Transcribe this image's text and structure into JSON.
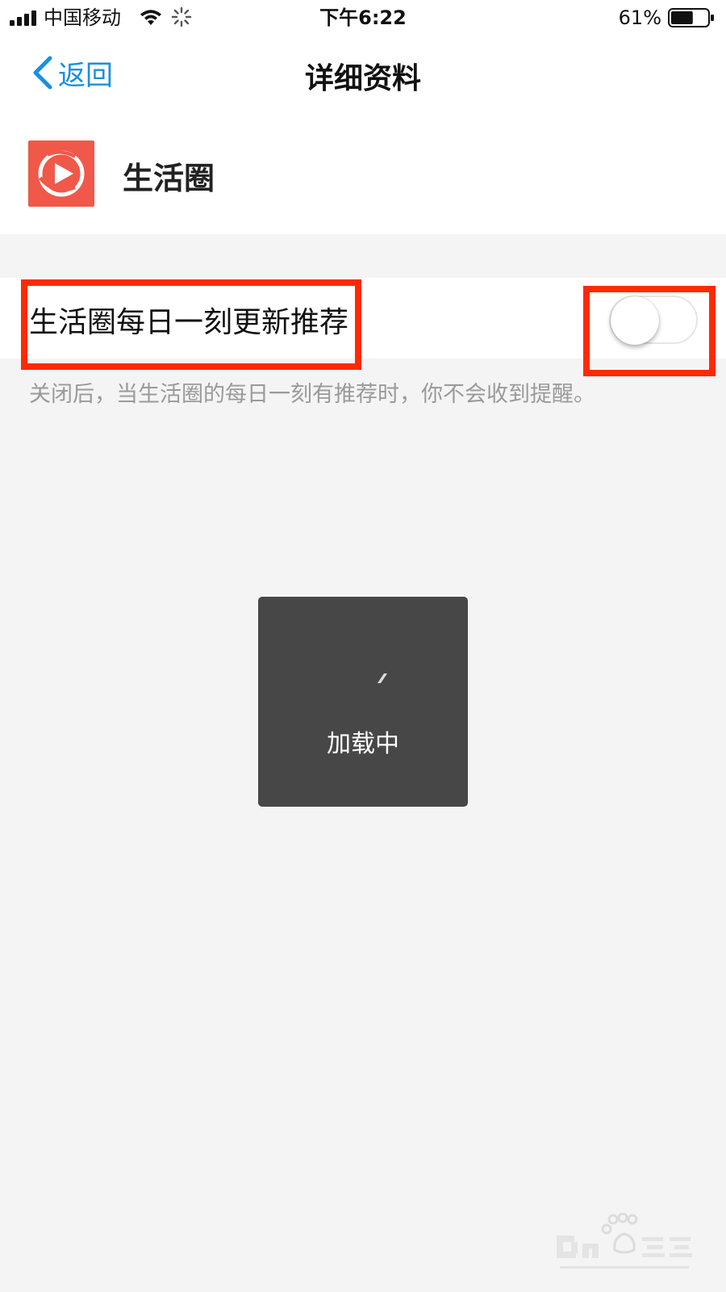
{
  "status_bar": {
    "carrier": "中国移动",
    "time": "下午6:22",
    "battery_percent": "61%",
    "battery_level": 0.61,
    "icons": [
      "signal-icon",
      "wifi-icon",
      "activity-icon",
      "battery-icon"
    ]
  },
  "nav": {
    "back_label": "返回",
    "title": "详细资料",
    "accent_color": "#1a8fe0"
  },
  "profile": {
    "app_name": "生活圈",
    "logo_icon": "play-circle-icon",
    "logo_color": "#f0584a"
  },
  "setting": {
    "label": "生活圈每日一刻更新推荐",
    "toggle_state": "off",
    "hint": "关闭后，当生活圈的每日一刻有推荐时，你不会收到提醒。"
  },
  "loading": {
    "text": "加载中"
  },
  "annotation_color": "#ff2a00"
}
